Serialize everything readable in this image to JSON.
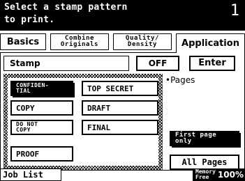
{
  "header": {
    "message": "Select a stamp pattern\nto print.",
    "job_number": "1"
  },
  "tabs": [
    {
      "label": "Basics",
      "active": false
    },
    {
      "line1": "Combine",
      "line2": "Originals",
      "active": false
    },
    {
      "line1": "Quality/",
      "line2": "Density",
      "active": false
    },
    {
      "label": "Application",
      "active": true
    }
  ],
  "stamp": {
    "label": "Stamp",
    "value": "OFF",
    "enter_label": "Enter"
  },
  "stamp_options": [
    {
      "line1": "CONFIDEN-",
      "line2": "TIAL",
      "selected": true
    },
    {
      "label": "TOP SECRET",
      "selected": false
    },
    {
      "label": "COPY",
      "selected": false
    },
    {
      "label": "DRAFT",
      "selected": false
    },
    {
      "line1": "DO NOT",
      "line2": "COPY",
      "selected": false
    },
    {
      "label": "FINAL",
      "selected": false
    },
    {
      "label": "PROOF",
      "selected": false
    }
  ],
  "pages": {
    "label": "•Pages",
    "options": [
      {
        "line1": "First page",
        "line2": "only",
        "selected": true
      },
      {
        "label": "All Pages",
        "selected": false
      }
    ]
  },
  "footer": {
    "job_list_label": "Job List",
    "memory_label": "Memory\nFree",
    "memory_value": "100%"
  }
}
